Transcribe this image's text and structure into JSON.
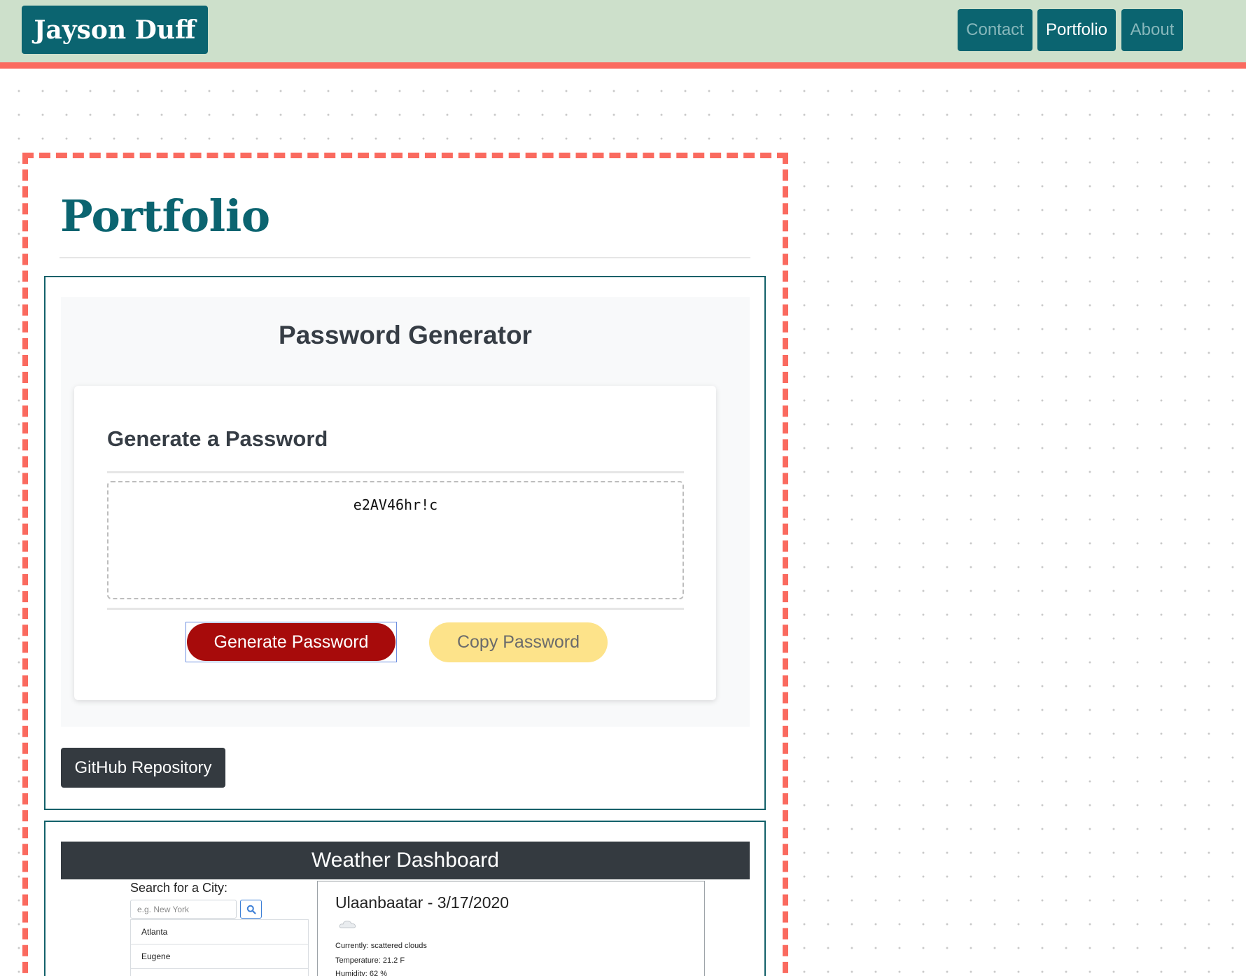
{
  "header": {
    "brand": "Jayson Duff",
    "nav": [
      {
        "label": "Contact",
        "active": false
      },
      {
        "label": "Portfolio",
        "active": true
      },
      {
        "label": "About",
        "active": false
      }
    ]
  },
  "colors": {
    "header_bg": "#cde0cb",
    "accent": "#fa6a5f",
    "brand_teal": "#0b6470",
    "generate_button": "#a70b0b",
    "copy_button": "#fde38a"
  },
  "main": {
    "title": "Portfolio",
    "projects": [
      {
        "preview": {
          "title": "Password Generator",
          "card_heading": "Generate a Password",
          "password": "e2AV46hr!c",
          "generate_label": "Generate Password",
          "copy_label": "Copy Password"
        },
        "repo_label": "GitHub Repository"
      },
      {
        "preview": {
          "title": "Weather Dashboard",
          "search_label": "Search for a City:",
          "search_placeholder": "e.g. New York",
          "search_icon": "search-icon",
          "cities": [
            "Atlanta",
            "Eugene",
            ""
          ],
          "current_city": "Ulaanbaatar - 3/17/2020",
          "weather_icon": "cloud-icon",
          "currently": "Currently: scattered clouds",
          "temperature": "Temperature: 21.2 F",
          "humidity": "Humidity: 62 %"
        }
      }
    ]
  }
}
